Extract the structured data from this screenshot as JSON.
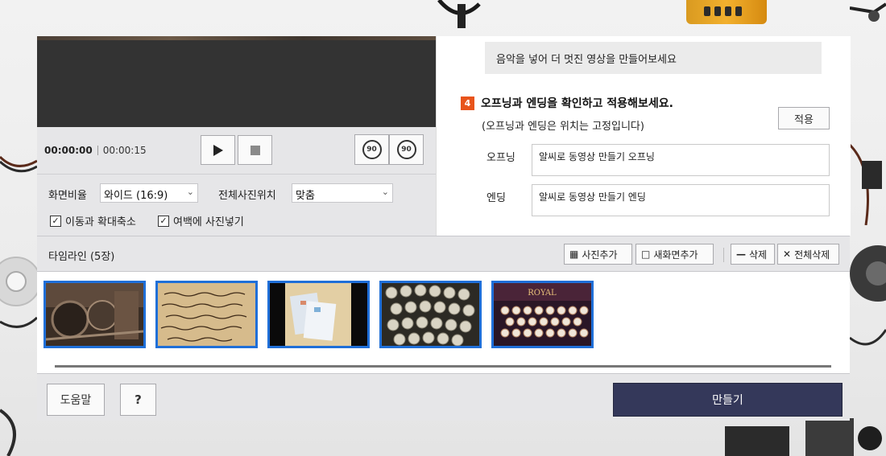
{
  "player": {
    "time_current": "00:00:00",
    "time_total": "00:00:15",
    "rotate_left_label": "90",
    "rotate_right_label": "90"
  },
  "options": {
    "aspect_label": "화면비율",
    "aspect_value": "와이드 (16:9)",
    "photo_position_label": "전체사진위치",
    "photo_position_value": "맞춤",
    "pan_zoom_label": "이동과 확대축소",
    "pan_zoom_checked": true,
    "fill_margin_label": "여백에 사진넣기",
    "fill_margin_checked": true
  },
  "right_panel": {
    "tip_text": "음악을 넣어 더 멋진 영상을 만들어보세요",
    "step_number": "4",
    "step_title": "오프닝과 엔딩을 확인하고 적용해보세요.",
    "step_subtitle": "(오프닝과 엔딩은 위치는 고정입니다)",
    "apply_label": "적용",
    "opening_label": "오프닝",
    "opening_value": "알씨로 동영상 만들기 오프닝",
    "ending_label": "엔딩",
    "ending_value": "알씨로 동영상 만들기 엔딩"
  },
  "timeline": {
    "title": "타임라인 (5장)",
    "add_photo_label": "사진추가",
    "add_screen_label": "새화면추가",
    "delete_label": "삭제",
    "delete_all_label": "전체삭제",
    "thumbnails": [
      {
        "name": "typewriter-closeup"
      },
      {
        "name": "handwritten-letter"
      },
      {
        "name": "envelopes"
      },
      {
        "name": "typewriter-keys"
      },
      {
        "name": "royal-typewriter"
      }
    ],
    "royal_text": "ROYAL"
  },
  "footer": {
    "help_label": "도움말",
    "question_label": "?",
    "make_label": "만들기"
  },
  "colors": {
    "accent_blue": "#1f6fd8",
    "step_orange": "#e8541b",
    "make_button": "#34385a"
  }
}
